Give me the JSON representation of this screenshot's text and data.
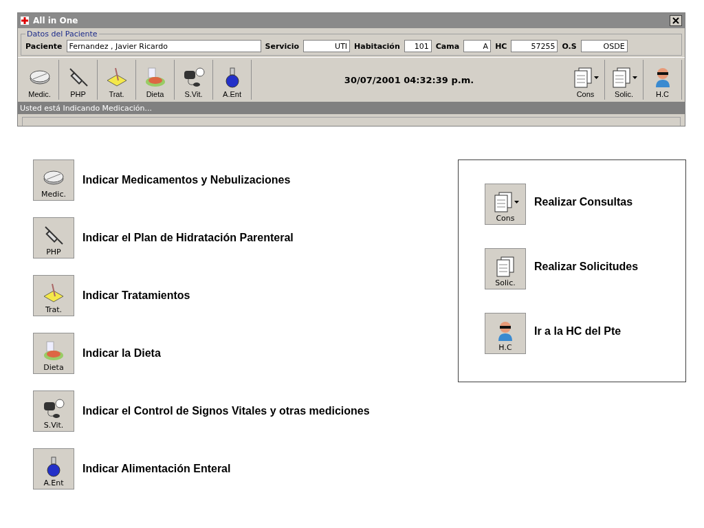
{
  "window": {
    "title": "All in One"
  },
  "patient": {
    "group_title": "Datos del Paciente",
    "fields": [
      {
        "label": "Paciente",
        "value": "Fernandez , Javier Ricardo",
        "kind": "wide"
      },
      {
        "label": "Servicio",
        "value": "UTI",
        "kind": "mid"
      },
      {
        "label": "Habitación",
        "value": "101",
        "kind": "small"
      },
      {
        "label": "Cama",
        "value": "A",
        "kind": "small"
      },
      {
        "label": "HC",
        "value": "57255",
        "kind": "mid"
      },
      {
        "label": "O.S",
        "value": "OSDE",
        "kind": "mid"
      }
    ]
  },
  "toolbar": {
    "left": [
      {
        "label": "Medic.",
        "kind": "pill"
      },
      {
        "label": "PHP",
        "kind": "syringe"
      },
      {
        "label": "Trat.",
        "kind": "pad"
      },
      {
        "label": "Dieta",
        "kind": "food"
      },
      {
        "label": "S.Vit.",
        "kind": "meter"
      },
      {
        "label": "A.Ent",
        "kind": "flask"
      }
    ],
    "datetime": "30/07/2001 04:32:39 p.m.",
    "right": [
      {
        "label": "Cons",
        "kind": "docs",
        "dropdown": true
      },
      {
        "label": "Solic.",
        "kind": "docs",
        "dropdown": true
      },
      {
        "label": "H.C",
        "kind": "person",
        "dropdown": false
      }
    ]
  },
  "status_bar": "Usted está Indicando Medicación...",
  "legend_left": [
    {
      "icon": {
        "label": "Medic.",
        "kind": "pill",
        "dropdown": false
      },
      "text": "Indicar Medicamentos y Nebulizaciones"
    },
    {
      "icon": {
        "label": "PHP",
        "kind": "syringe",
        "dropdown": false
      },
      "text": "Indicar el Plan de Hidratación Parenteral"
    },
    {
      "icon": {
        "label": "Trat.",
        "kind": "pad",
        "dropdown": false
      },
      "text": "Indicar Tratamientos"
    },
    {
      "icon": {
        "label": "Dieta",
        "kind": "food",
        "dropdown": false
      },
      "text": "Indicar la Dieta"
    },
    {
      "icon": {
        "label": "S.Vit.",
        "kind": "meter",
        "dropdown": false
      },
      "text": "Indicar el Control de Signos Vitales y otras mediciones"
    },
    {
      "icon": {
        "label": "A.Ent",
        "kind": "flask",
        "dropdown": false
      },
      "text": "Indicar Alimentación Enteral"
    }
  ],
  "legend_right": [
    {
      "icon": {
        "label": "Cons",
        "kind": "docs",
        "dropdown": true
      },
      "text": "Realizar Consultas"
    },
    {
      "icon": {
        "label": "Solic.",
        "kind": "docs",
        "dropdown": false
      },
      "text": "Realizar Solicitudes"
    },
    {
      "icon": {
        "label": "H.C",
        "kind": "person",
        "dropdown": false
      },
      "text": "Ir a la HC del Pte"
    }
  ]
}
